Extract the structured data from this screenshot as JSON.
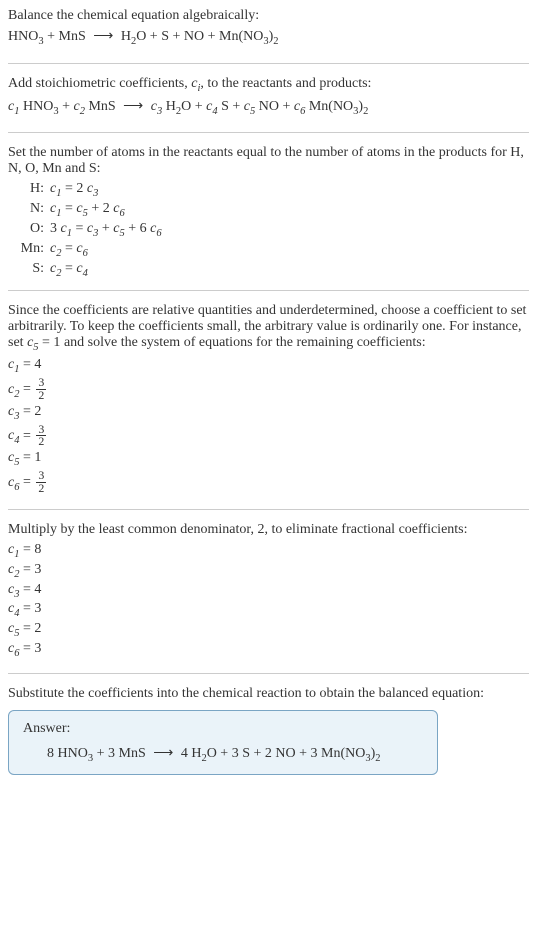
{
  "section1": {
    "intro": "Balance the chemical equation algebraically:",
    "equation_lhs1": "HNO",
    "equation_lhs1_sub": "3",
    "plus1": " + MnS ",
    "arrow": "⟶",
    "rhs": " H",
    "rhs_sub1": "2",
    "rhs2": "O + S + NO + Mn(NO",
    "rhs_sub2": "3",
    "rhs3": ")",
    "rhs_sub3": "2"
  },
  "section2": {
    "intro_a": "Add stoichiometric coefficients, ",
    "intro_ci": "c",
    "intro_ci_sub": "i",
    "intro_b": ", to the reactants and products:",
    "c1": "c",
    "c1s": "1",
    "t1": " HNO",
    "t1s": "3",
    "plus1": " + ",
    "c2": "c",
    "c2s": "2",
    "t2": " MnS ",
    "arrow": "⟶",
    "c3": " c",
    "c3s": "3",
    "t3": " H",
    "t3s": "2",
    "t3b": "O + ",
    "c4": "c",
    "c4s": "4",
    "t4": " S + ",
    "c5": "c",
    "c5s": "5",
    "t5": " NO + ",
    "c6": "c",
    "c6s": "6",
    "t6": " Mn(NO",
    "t6s": "3",
    "t6b": ")",
    "t6s2": "2"
  },
  "section3": {
    "intro": "Set the number of atoms in the reactants equal to the number of atoms in the products for H, N, O, Mn and S:",
    "atoms": [
      {
        "label": "H:",
        "c_a": "c",
        "s_a": "1",
        "eq": " = 2 ",
        "c_b": "c",
        "s_b": "3",
        "rest": ""
      },
      {
        "label": "N:",
        "c_a": "c",
        "s_a": "1",
        "eq": " = ",
        "c_b": "c",
        "s_b": "5",
        "rest_a": " + 2 ",
        "c_c": "c",
        "s_c": "6"
      },
      {
        "label": "O:",
        "pre": "3 ",
        "c_a": "c",
        "s_a": "1",
        "eq": " = ",
        "c_b": "c",
        "s_b": "3",
        "rest_a": " + ",
        "c_c": "c",
        "s_c": "5",
        "rest_b": " + 6 ",
        "c_d": "c",
        "s_d": "6"
      },
      {
        "label": "Mn:",
        "c_a": "c",
        "s_a": "2",
        "eq": " = ",
        "c_b": "c",
        "s_b": "6",
        "rest": ""
      },
      {
        "label": "S:",
        "c_a": "c",
        "s_a": "2",
        "eq": " = ",
        "c_b": "c",
        "s_b": "4",
        "rest": ""
      }
    ]
  },
  "section4": {
    "intro_a": "Since the coefficients are relative quantities and underdetermined, choose a coefficient to set arbitrarily. To keep the coefficients small, the arbitrary value is ordinarily one. For instance, set ",
    "c5": "c",
    "c5s": "5",
    "eq1": " = 1",
    "intro_b": " and solve the system of equations for the remaining coefficients:",
    "coeffs": [
      {
        "c": "c",
        "s": "1",
        "eq": " = 4",
        "frac": null
      },
      {
        "c": "c",
        "s": "2",
        "eq": " = ",
        "frac": {
          "num": "3",
          "den": "2"
        }
      },
      {
        "c": "c",
        "s": "3",
        "eq": " = 2",
        "frac": null
      },
      {
        "c": "c",
        "s": "4",
        "eq": " = ",
        "frac": {
          "num": "3",
          "den": "2"
        }
      },
      {
        "c": "c",
        "s": "5",
        "eq": " = 1",
        "frac": null
      },
      {
        "c": "c",
        "s": "6",
        "eq": " = ",
        "frac": {
          "num": "3",
          "den": "2"
        }
      }
    ]
  },
  "section5": {
    "intro": "Multiply by the least common denominator, 2, to eliminate fractional coefficients:",
    "coeffs": [
      {
        "c": "c",
        "s": "1",
        "eq": " = 8"
      },
      {
        "c": "c",
        "s": "2",
        "eq": " = 3"
      },
      {
        "c": "c",
        "s": "3",
        "eq": " = 4"
      },
      {
        "c": "c",
        "s": "4",
        "eq": " = 3"
      },
      {
        "c": "c",
        "s": "5",
        "eq": " = 2"
      },
      {
        "c": "c",
        "s": "6",
        "eq": " = 3"
      }
    ]
  },
  "section6": {
    "intro": "Substitute the coefficients into the chemical reaction to obtain the balanced equation:",
    "answer_label": "Answer:",
    "eq_a": "8 HNO",
    "eq_as": "3",
    "eq_b": " + 3 MnS ",
    "arrow": "⟶",
    "eq_c": " 4 H",
    "eq_cs": "2",
    "eq_d": "O + 3 S + 2 NO + 3 Mn(NO",
    "eq_ds": "3",
    "eq_e": ")",
    "eq_es": "2"
  }
}
